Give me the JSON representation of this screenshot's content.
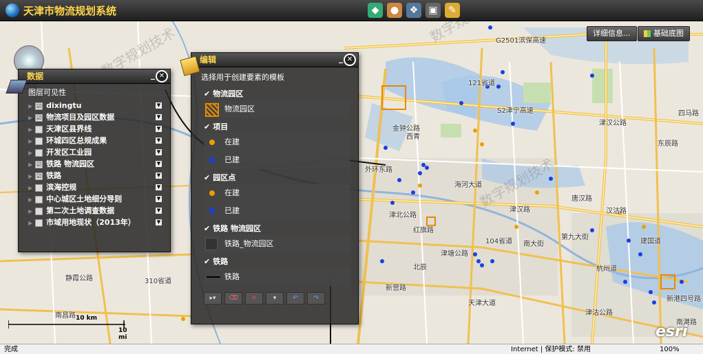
{
  "app": {
    "title": "天津市物流规划系统"
  },
  "header_buttons": {
    "details": "详细信息...",
    "basemap": "基础底图"
  },
  "watermark": [
    "数字规划技术",
    "数字规划"
  ],
  "data_panel": {
    "title": "数据",
    "visibility_label": "图层可见性",
    "layers": [
      {
        "label": "dixingtu",
        "checked": "☑"
      },
      {
        "label": "物流项目及园区数据",
        "checked": "☑"
      },
      {
        "label": "天津区县界线",
        "checked": ""
      },
      {
        "label": "环城四区总规成果",
        "checked": ""
      },
      {
        "label": "开发区工业园",
        "checked": ""
      },
      {
        "label": "铁路 物流园区",
        "checked": "☑"
      },
      {
        "label": "铁路",
        "checked": "☑"
      },
      {
        "label": "滨海控规",
        "checked": ""
      },
      {
        "label": "中心城区土地细分导则",
        "checked": ""
      },
      {
        "label": "第二次土地调查数据",
        "checked": ""
      },
      {
        "label": "市域用地现状（2013年）",
        "checked": ""
      }
    ]
  },
  "edit_panel": {
    "title": "编辑",
    "prompt": "选择用于创建要素的模板",
    "groups": [
      {
        "title": "物流园区",
        "items": [
          "物流园区"
        ]
      },
      {
        "title": "项目",
        "items": [
          "在建",
          "已建"
        ]
      },
      {
        "title": "园区点",
        "items": [
          "在建",
          "已建"
        ]
      },
      {
        "title": "铁路 物流园区",
        "items": [
          "铁路_物流园区"
        ]
      },
      {
        "title": "铁路",
        "items": [
          "铁路"
        ]
      }
    ]
  },
  "map_labels": [
    "G2501滨保高速",
    "121省道",
    "S2津宁高速",
    "津汉公路",
    "四马路",
    "金钟公路",
    "外环东路",
    "津北公路",
    "津塘公路",
    "南大街",
    "第九大街",
    "天津大道",
    "津沽公路",
    "静霞公路",
    "杭州道",
    "新港四号路",
    "南港路",
    "津汉路",
    "北辰",
    "东辰路",
    "唐汉路",
    "104省道",
    "310省道",
    "汉沽路",
    "海河大道",
    "新营路",
    "建国道",
    "红旗路",
    "西青",
    "南昌路"
  ],
  "scale": {
    "km": "10 km",
    "mi": "10 mi"
  },
  "status": {
    "left": "完成",
    "zone": "Internet | 保护模式: 禁用",
    "zoom": "100%"
  },
  "colors": {
    "accent": "#ffd54a",
    "project_building": "#e8a000",
    "project_built": "#1a3fe0",
    "logistics_park": "#e88a00"
  }
}
